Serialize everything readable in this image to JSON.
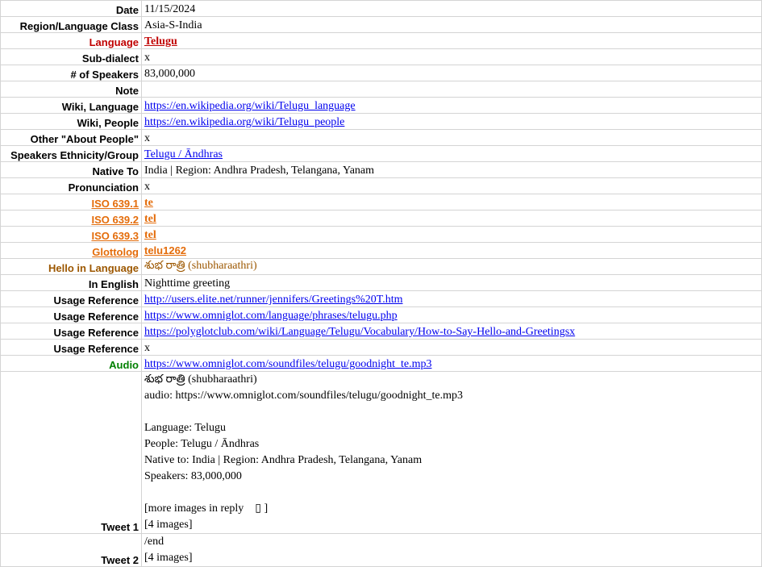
{
  "rows": [
    {
      "label": "Date",
      "value": "11/15/2024"
    },
    {
      "label": "Region/Language Class",
      "value": "Asia-S-India"
    },
    {
      "label": "Language",
      "value": "Telugu"
    },
    {
      "label": "Sub-dialect",
      "value": "x"
    },
    {
      "label": "# of Speakers",
      "value": "83,000,000"
    },
    {
      "label": "Note",
      "value": ""
    },
    {
      "label": "Wiki, Language",
      "value": "https://en.wikipedia.org/wiki/Telugu_language"
    },
    {
      "label": "Wiki, People",
      "value": "https://en.wikipedia.org/wiki/Telugu_people"
    },
    {
      "label": "Other \"About People\"",
      "value": "x"
    },
    {
      "label": "Speakers Ethnicity/Group",
      "value": "Telugu / Āndhras"
    },
    {
      "label": "Native To",
      "value": "India | Region: Andhra Pradesh, Telangana, Yanam"
    },
    {
      "label": "Pronunciation",
      "value": "x"
    },
    {
      "label": "ISO 639.1",
      "value": "te"
    },
    {
      "label": "ISO 639.2",
      "value": "tel"
    },
    {
      "label": "ISO 639.3",
      "value": "tel"
    },
    {
      "label": "Glottolog",
      "value": "telu1262"
    },
    {
      "label": "Hello in Language",
      "value": "శుభ రాత్రి (shubharaathri)"
    },
    {
      "label": "In English",
      "value": "Nighttime greeting"
    },
    {
      "label": "Usage Reference",
      "value": "http://users.elite.net/runner/jennifers/Greetings%20T.htm"
    },
    {
      "label": "Usage Reference",
      "value": "https://www.omniglot.com/language/phrases/telugu.php"
    },
    {
      "label": "Usage Reference",
      "value": "https://polyglotclub.com/wiki/Language/Telugu/Vocabulary/How-to-Say-Hello-and-Greetingsx"
    },
    {
      "label": "Usage Reference",
      "value": "x"
    },
    {
      "label": "Audio",
      "value": "https://www.omniglot.com/soundfiles/telugu/goodnight_te.mp3"
    },
    {
      "label": "Tweet 1",
      "value": "శుభ రాత్రి (shubharaathri)\naudio: https://www.omniglot.com/soundfiles/telugu/goodnight_te.mp3\n\nLanguage: Telugu\nPeople: Telugu / Āndhras\nNative to: India | Region: Andhra Pradesh, Telangana, Yanam\nSpeakers: 83,000,000\n\n[more images in reply    ▯ ]\n[4 images]"
    },
    {
      "label": "Tweet 2",
      "value": "/end\n[4 images]"
    }
  ]
}
